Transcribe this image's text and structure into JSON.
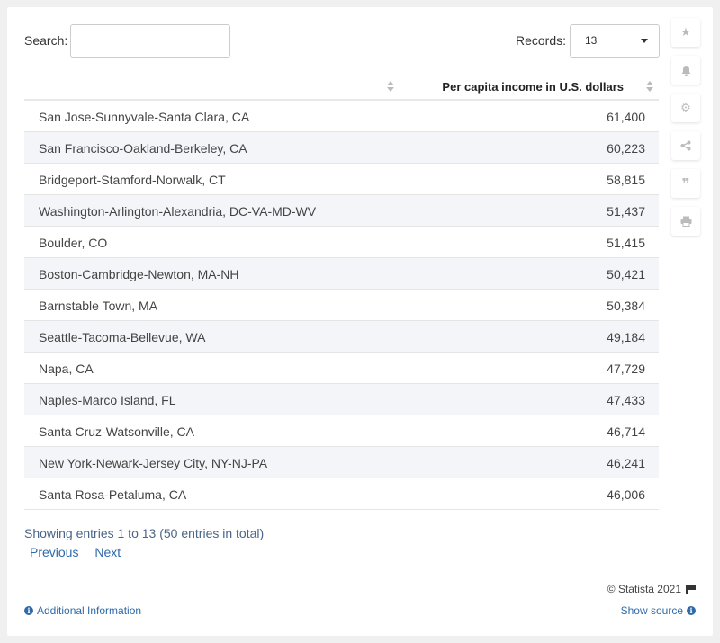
{
  "search": {
    "label": "Search:",
    "value": "",
    "placeholder": ""
  },
  "records": {
    "label": "Records:",
    "value": "13"
  },
  "table": {
    "columns": [
      "",
      "Per capita income in U.S. dollars"
    ],
    "rows": [
      {
        "name": "San Jose-Sunnyvale-Santa Clara, CA",
        "value": "61,400"
      },
      {
        "name": "San Francisco-Oakland-Berkeley, CA",
        "value": "60,223"
      },
      {
        "name": "Bridgeport-Stamford-Norwalk, CT",
        "value": "58,815"
      },
      {
        "name": "Washington-Arlington-Alexandria, DC-VA-MD-WV",
        "value": "51,437"
      },
      {
        "name": "Boulder, CO",
        "value": "51,415"
      },
      {
        "name": "Boston-Cambridge-Newton, MA-NH",
        "value": "50,421"
      },
      {
        "name": "Barnstable Town, MA",
        "value": "50,384"
      },
      {
        "name": "Seattle-Tacoma-Bellevue, WA",
        "value": "49,184"
      },
      {
        "name": "Napa, CA",
        "value": "47,729"
      },
      {
        "name": "Naples-Marco Island, FL",
        "value": "47,433"
      },
      {
        "name": "Santa Cruz-Watsonville, CA",
        "value": "46,714"
      },
      {
        "name": "New York-Newark-Jersey City, NY-NJ-PA",
        "value": "46,241"
      },
      {
        "name": "Santa Rosa-Petaluma, CA",
        "value": "46,006"
      }
    ]
  },
  "footer": {
    "showing": "Showing entries 1 to 13 (50 entries in total)",
    "previous": "Previous",
    "next": "Next",
    "copyright": "© Statista 2021",
    "additional_info": "Additional Information",
    "show_source": "Show source"
  },
  "sidebar": {
    "icons": [
      "star-icon",
      "bell-icon",
      "gear-icon",
      "share-icon",
      "quote-icon",
      "print-icon"
    ]
  }
}
